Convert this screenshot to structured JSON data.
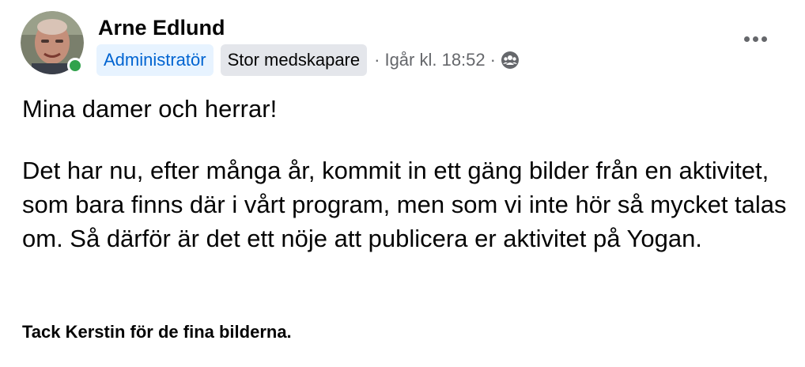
{
  "post": {
    "author": "Arne Edlund",
    "badges": {
      "admin": "Administratör",
      "creator": "Stor medskapare"
    },
    "separator": "·",
    "timestamp": "Igår kl. 18:52",
    "audience_icon": "group-audience-icon",
    "online_status_color": "#31a24c",
    "greeting": "Mina damer och herrar!",
    "body": "Det har nu, efter många år, kommit in ett gäng bilder från en aktivitet, som bara finns där i vårt program, men som vi inte hör så mycket talas om. Så därför är det ett nöje att publicera er aktivitet på Yogan.",
    "thanks": "Tack Kerstin för de fina bilderna."
  },
  "colors": {
    "admin_badge_bg": "#e7f3ff",
    "admin_badge_text": "#0064d1",
    "creator_badge_bg": "#e4e6eb",
    "meta_text": "#65676b",
    "body_text": "#050505"
  },
  "icons": {
    "more": "more-options-icon",
    "audience": "group-audience-icon"
  }
}
